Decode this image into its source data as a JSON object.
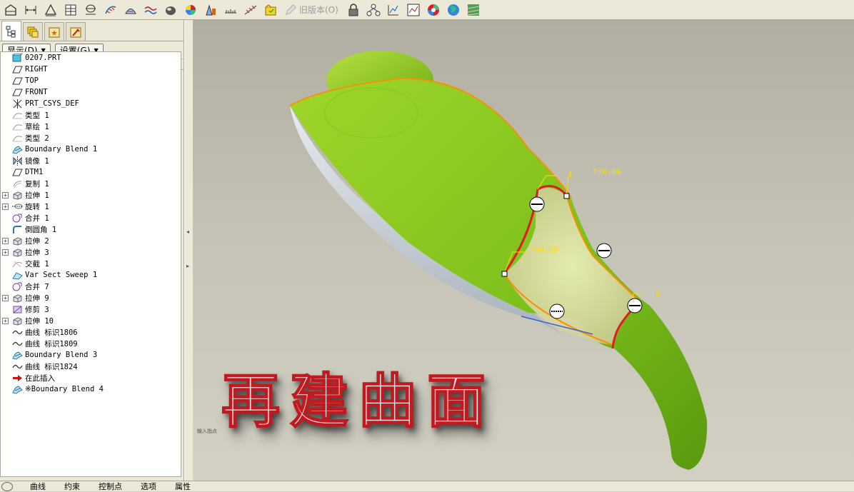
{
  "toolbar": {
    "icons": [
      "datum-plane-icon",
      "dimension-icon",
      "triangle-icon",
      "table-icon",
      "section-icon",
      "curve-analysis-icon",
      "draft-analysis-icon",
      "curvature-icon",
      "shade-analysis-icon",
      "color-map-icon",
      "measure-icon",
      "ruler-icon",
      "sweep-analysis-icon",
      "folder-check-icon"
    ],
    "old_version_label": "旧版本(O)",
    "icons_right": [
      "lock-icon",
      "network-icon",
      "plot-icon",
      "graph-icon",
      "color-wheel-icon",
      "globe-icon",
      "texture-icon"
    ]
  },
  "panel": {
    "tabs": [
      "model-tree-tab",
      "layers-tab",
      "star-tab",
      "tools-tab"
    ],
    "show_label": "显示(D)",
    "settings_label": "设置(G)"
  },
  "tree": {
    "items": [
      {
        "label": "0207.PRT",
        "icon": "part-icon",
        "expand": ""
      },
      {
        "label": "RIGHT",
        "icon": "datum-plane-icon",
        "expand": ""
      },
      {
        "label": "TOP",
        "icon": "datum-plane-icon",
        "expand": ""
      },
      {
        "label": "FRONT",
        "icon": "datum-plane-icon",
        "expand": ""
      },
      {
        "label": "PRT_CSYS_DEF",
        "icon": "csys-icon",
        "expand": ""
      },
      {
        "label": "类型 1",
        "icon": "sketch-icon",
        "expand": ""
      },
      {
        "label": "草绘 1",
        "icon": "sketch-icon",
        "expand": ""
      },
      {
        "label": "类型 2",
        "icon": "sketch-icon",
        "expand": ""
      },
      {
        "label": "Boundary Blend 1",
        "icon": "boundary-blend-icon",
        "expand": ""
      },
      {
        "label": "镜像 1",
        "icon": "mirror-icon",
        "expand": ""
      },
      {
        "label": "DTM1",
        "icon": "datum-plane-icon",
        "expand": ""
      },
      {
        "label": "复制 1",
        "icon": "copy-icon",
        "expand": ""
      },
      {
        "label": "拉伸 1",
        "icon": "extrude-icon",
        "expand": "+"
      },
      {
        "label": "旋转 1",
        "icon": "revolve-icon",
        "expand": "+"
      },
      {
        "label": "合并 1",
        "icon": "merge-icon",
        "expand": ""
      },
      {
        "label": "倒圆角 1",
        "icon": "round-icon",
        "expand": ""
      },
      {
        "label": "拉伸 2",
        "icon": "extrude-icon",
        "expand": "+"
      },
      {
        "label": "拉伸 3",
        "icon": "extrude-icon",
        "expand": "+"
      },
      {
        "label": "交截 1",
        "icon": "intersect-icon",
        "expand": ""
      },
      {
        "label": "Var Sect Sweep 1",
        "icon": "sweep-icon",
        "expand": ""
      },
      {
        "label": "合并 7",
        "icon": "merge-icon",
        "expand": ""
      },
      {
        "label": "拉伸 9",
        "icon": "extrude-icon",
        "expand": "+"
      },
      {
        "label": "修剪 3",
        "icon": "trim-icon",
        "expand": ""
      },
      {
        "label": "拉伸 10",
        "icon": "extrude-icon",
        "expand": "+"
      },
      {
        "label": "曲线 标识1806",
        "icon": "curve-icon",
        "expand": ""
      },
      {
        "label": "曲线 标识1809",
        "icon": "curve-icon",
        "expand": ""
      },
      {
        "label": "Boundary Blend 3",
        "icon": "boundary-blend-icon",
        "expand": ""
      },
      {
        "label": "曲线 标识1824",
        "icon": "curve-icon",
        "expand": ""
      },
      {
        "label": "在此插入",
        "icon": "insert-arrow-icon",
        "expand": ""
      },
      {
        "label": "※Boundary Blend 4",
        "icon": "boundary-blend-icon",
        "expand": ""
      }
    ]
  },
  "viewport": {
    "overlay_title": "再建曲面",
    "annotations": {
      "t_top": "T=0.00",
      "t_mid": "T=0.00",
      "label_1": "1",
      "label_2": "2",
      "small_note": "输入指点"
    }
  },
  "statusbar": {
    "tabs": [
      "曲线",
      "约束",
      "控制点",
      "选项",
      "属性"
    ]
  }
}
